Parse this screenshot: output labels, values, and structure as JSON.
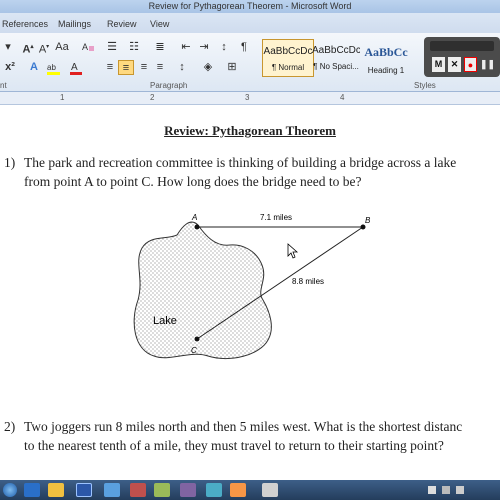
{
  "window": {
    "title": "Review for Pythagorean Theorem - Microsoft Word"
  },
  "tabs": [
    "References",
    "Mailings",
    "Review",
    "View"
  ],
  "ribbon": {
    "groups": [
      "nt",
      "Paragraph",
      "Styles"
    ],
    "styles": [
      {
        "sample": "AaBbCcDc",
        "name": "¶ Normal"
      },
      {
        "sample": "AaBbCcDc",
        "name": "¶ No Spaci..."
      },
      {
        "sample": "AaBbCc",
        "name": "Heading 1"
      }
    ],
    "recorder_buttons": [
      "M",
      "✕",
      "●",
      "❚❚"
    ]
  },
  "ruler_numbers": [
    "1",
    "2",
    "3",
    "4"
  ],
  "document": {
    "heading": "Review:  Pythagorean Theorem",
    "q1_num": "1)",
    "q1_line1": "The park and recreation committee is thinking of building a bridge across a lake",
    "q1_line2": "from point A to point C.  How long does the bridge need to be?",
    "figure": {
      "label_a": "A",
      "label_b": "B",
      "label_c": "C",
      "ab_label": "7.1 miles",
      "bc_label": "8.8 miles",
      "lake_label": "Lake"
    },
    "q2_num": "2)",
    "q2_line1": "Two joggers run 8 miles north and then 5 miles west.  What is the shortest distanc",
    "q2_line2": "to the nearest tenth of a mile, they must travel to return to their starting point?"
  },
  "colors": {
    "taskbar": "#2d4a6e",
    "ribbon": "#dde7f3",
    "titlebar": "#bcd3ee"
  }
}
